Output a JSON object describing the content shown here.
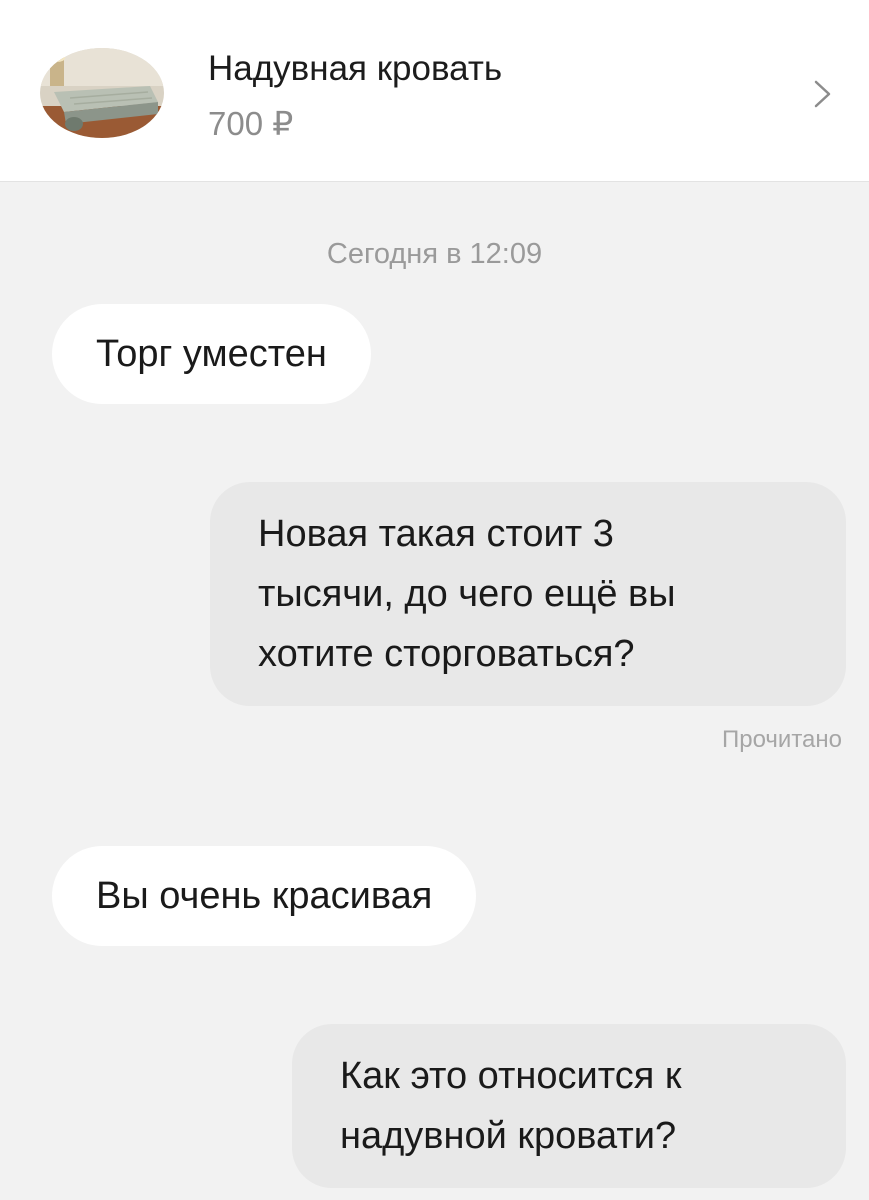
{
  "header": {
    "item_title": "Надувная кровать",
    "item_price": "700 ₽",
    "thumbnail_icon": "air-mattress-photo",
    "chevron_icon": "chevron-right-icon"
  },
  "chat": {
    "date_label": "Сегодня в 12:09",
    "messages": [
      {
        "direction": "incoming",
        "lines": [
          "Торг уместен"
        ]
      },
      {
        "direction": "outgoing",
        "lines": [
          "Новая такая стоит 3",
          "тысячи, до чего ещё вы",
          "хотите сторговаться?"
        ]
      },
      {
        "direction": "incoming",
        "lines": [
          "Вы очень красивая"
        ]
      },
      {
        "direction": "outgoing",
        "lines": [
          "Как это относится к",
          "надувной кровати?"
        ]
      }
    ],
    "read_status": "Прочитано"
  },
  "colors": {
    "background": "#f2f2f2",
    "header_background": "#ffffff",
    "incoming_bubble": "#ffffff",
    "outgoing_bubble": "#e8e8e8",
    "muted_text": "#9a9a9a"
  }
}
